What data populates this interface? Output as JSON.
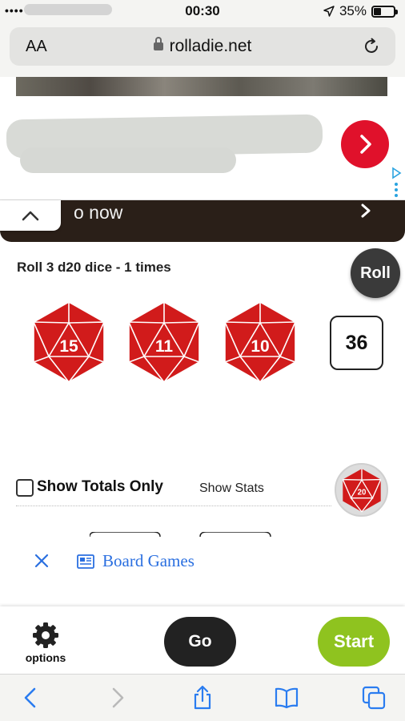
{
  "status_bar": {
    "carrier": "••••",
    "time": "00:30",
    "battery_percent": "35%",
    "battery_level": 0.35
  },
  "address_bar": {
    "text_size_label": "AA",
    "url": "rolladie.net"
  },
  "ad": {
    "cta_fragment": "o now"
  },
  "roller": {
    "roll_description": "Roll 3 d20 dice - 1 times",
    "roll_button": "Roll",
    "dice": [
      {
        "type": "d20",
        "value": "15",
        "color": "#d11b1b"
      },
      {
        "type": "d20",
        "value": "11",
        "color": "#d11b1b"
      },
      {
        "type": "d20",
        "value": "10",
        "color": "#d11b1b"
      }
    ],
    "total": "36",
    "show_totals_only_label": "Show Totals Only",
    "show_totals_only_checked": false,
    "show_stats_label": "Show Stats",
    "dice_type_badge": "20"
  },
  "board_games": {
    "link_label": "Board Games",
    "accent": "#2a6fe0"
  },
  "app_bar": {
    "options_label": "options",
    "go_label": "Go",
    "start_label": "Start",
    "start_color": "#8fc31f"
  },
  "icons": {
    "address": [
      "lock-icon",
      "reload-icon"
    ],
    "safari_toolbar": [
      "back-icon",
      "forward-icon",
      "share-icon",
      "bookmarks-icon",
      "tabs-icon"
    ]
  }
}
